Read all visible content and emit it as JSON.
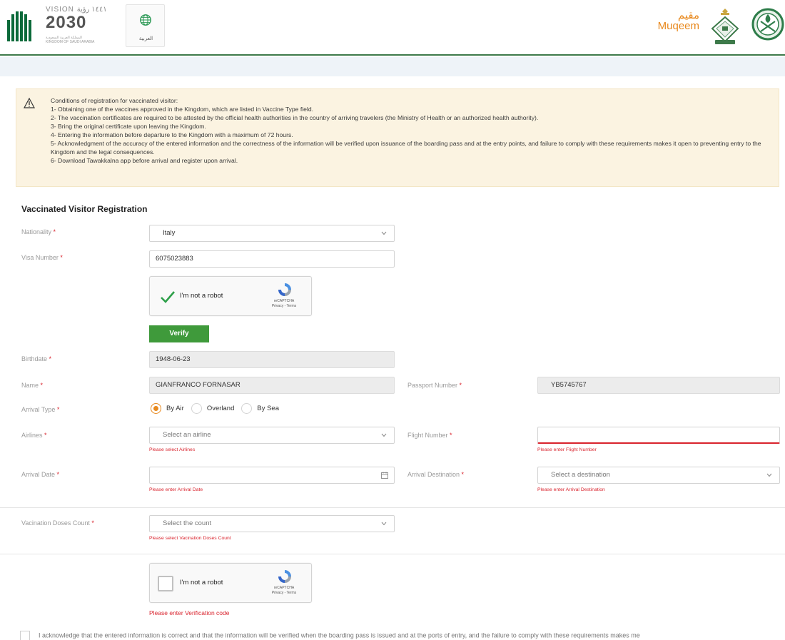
{
  "header": {
    "vision_top": "VISION ١٤٤١ رؤية",
    "vision_year": "2030",
    "vision_sub_ar": "المملكة العربية السعودية",
    "vision_sub_en": "KINGDOM OF SAUDI ARABIA",
    "lang_label": "العربية",
    "muqeem_ar": "مقيم",
    "muqeem_en": "Muqeem",
    "brand_color": "#e8891e",
    "accent_green": "#3d7a4a"
  },
  "conditions": {
    "icon": "warning-icon",
    "lines": [
      "Conditions of registration for vaccinated visitor:",
      "1- Obtaining one of the vaccines approved in the Kingdom, which are listed in Vaccine Type field.",
      "2- The vaccination certificates are required to be attested by the official health authorities in the country of arriving travelers (the Ministry of Health or an authorized health authority).",
      "3- Bring the original certificate upon leaving the Kingdom.",
      "4- Entering the information before departure to the Kingdom with a maximum of 72 hours.",
      "5- Acknowledgment of the accuracy of the entered information and the correctness of the information will be verified upon issuance of the boarding pass and at the entry points, and failure to comply with these requirements makes it open to preventing entry to the Kingdom and the legal consequences.",
      "6- Download Tawakkalna app before arrival and register upon arrival."
    ]
  },
  "form": {
    "title": "Vaccinated Visitor Registration",
    "required_mark": "*",
    "nationality": {
      "label": "Nationality",
      "value": "Italy"
    },
    "visa": {
      "label": "Visa Number",
      "value": "6075023883"
    },
    "captcha1": {
      "label": "I'm not a robot",
      "brand": "reCAPTCHA",
      "links": "Privacy - Terms",
      "checked": true
    },
    "verify_label": "Verify",
    "birthdate": {
      "label": "Birthdate",
      "value": "1948-06-23"
    },
    "name": {
      "label": "Name",
      "value": "GIANFRANCO FORNASAR"
    },
    "passport": {
      "label": "Passport Number",
      "value": "YB5745767"
    },
    "arrival_type": {
      "label": "Arrival Type",
      "options": [
        "By Air",
        "Overland",
        "By Sea"
      ],
      "selected": "By Air"
    },
    "airlines": {
      "label": "Airlines",
      "placeholder": "Select an airline",
      "error": "Please select Airlines"
    },
    "flight": {
      "label": "Flight Number",
      "value": "",
      "error": "Please enter Flight Number"
    },
    "arrival_date": {
      "label": "Arrival Date",
      "value": "",
      "error": "Please enter Arrival Date"
    },
    "destination": {
      "label": "Arrival Destination",
      "placeholder": "Select a destination",
      "error": "Please enter Arrival Destination"
    },
    "doses": {
      "label": "Vacination Doses Count",
      "placeholder": "Select the count",
      "error": "Please select Vacination Doses Count"
    },
    "captcha2": {
      "label": "I'm not a robot",
      "brand": "reCAPTCHA",
      "links": "Privacy - Terms",
      "checked": false,
      "error": "Please enter Verification code"
    },
    "acknowledge": "I acknowledge that the entered information is correct and that the information will be verified when the boarding pass is issued and at the ports of entry, and the failure to comply with these requirements makes me"
  }
}
